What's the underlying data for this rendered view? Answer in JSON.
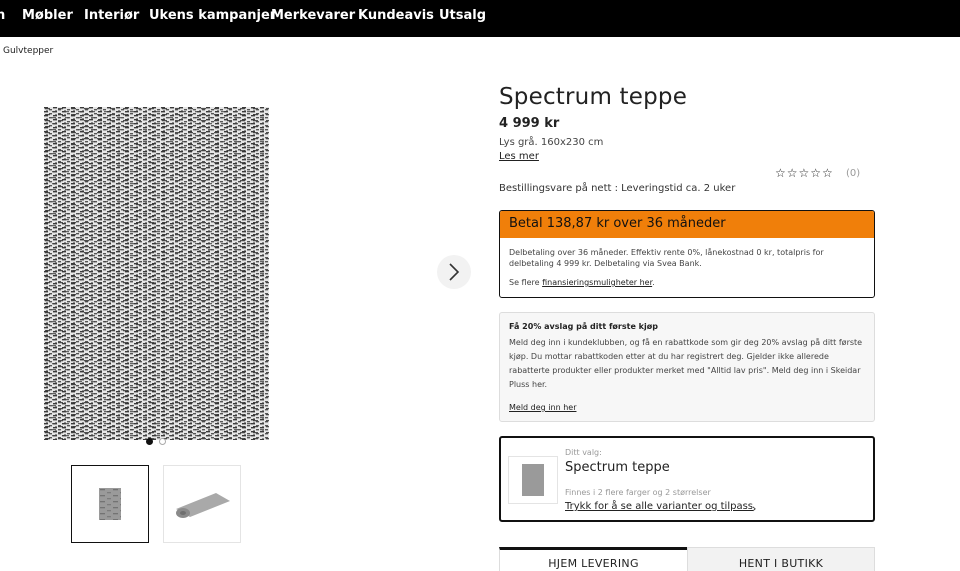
{
  "nav": {
    "items": [
      {
        "label": "Møbler"
      },
      {
        "label": "Interiør"
      },
      {
        "label": "Ukens kampanjer"
      },
      {
        "label": "Merkevarer"
      },
      {
        "label": "Kundeavis"
      },
      {
        "label": "Utsalg"
      }
    ]
  },
  "breadcrumb": "Gulvtepper",
  "gallery": {
    "next_icon": "chevron-right-icon",
    "dots": {
      "count": 2,
      "active": 1
    }
  },
  "product": {
    "title": "Spectrum teppe",
    "price": "4 999 kr",
    "variant": "Lys grå. 160x230 cm",
    "read_more": "Les mer",
    "stars": "☆☆☆☆☆",
    "rating": 0,
    "reviews": "(0)",
    "delivery": "Bestillingsvare på nett : Leveringstid ca. 2 uker"
  },
  "financing": {
    "heading": "Betal 138,87 kr over 36 måneder",
    "body": "Delbetaling over 36 måneder. Effektiv rente 0%, lånekostnad 0 kr, totalpris for delbetaling 4 999 kr. Delbetaling via Svea Bank.",
    "more_prefix": "Se flere ",
    "more_link": "finansieringsmuligheter her",
    "more_suffix": ".",
    "accent_color": "#f07f0a"
  },
  "club": {
    "heading": "Få 20% avslag på ditt første kjøp",
    "body": "Meld deg inn i kundeklubben, og få en rabattkode som gir deg 20% avslag på ditt første kjøp. Du mottar rabattkoden etter at du har registrert deg. Gjelder ikke allerede rabatterte produkter eller produkter merket med \"Alltid lav pris\". Meld deg inn i Skeidar Pluss her.",
    "link": "Meld deg inn her"
  },
  "choice": {
    "label": "Ditt valg:",
    "title": "Spectrum teppe",
    "sub": "Finnes i 2 flere farger og 2 størrelser",
    "link": "Trykk for å se alle varianter og tilpass",
    "chevron": "›"
  },
  "tabs": {
    "home": "HJEM LEVERING",
    "shop": "HENT I BUTIKK"
  }
}
